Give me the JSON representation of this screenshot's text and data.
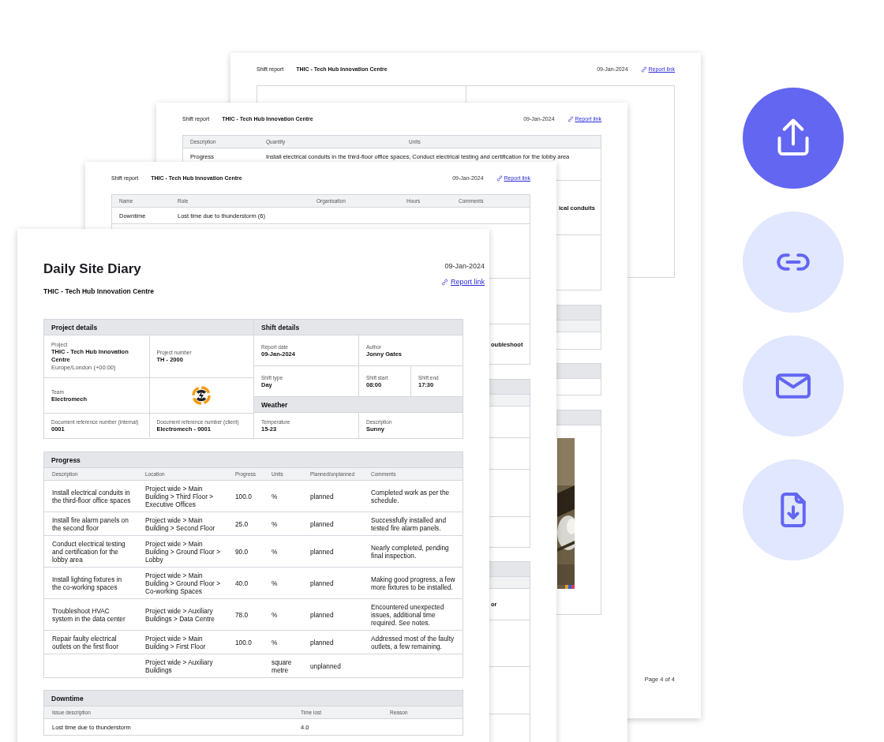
{
  "pages": [
    {
      "header": {
        "label": "Shift report",
        "project": "THIC - Tech Hub Innovation Centre",
        "date": "09-Jan-2024",
        "link": "Report link"
      },
      "footer": "Page 4 of 4"
    },
    {
      "header": {
        "label": "Shift report",
        "project": "THIC - Tech Hub Innovation Centre",
        "date": "09-Jan-2024",
        "link": "Report link"
      },
      "table": {
        "columns": [
          "Description",
          "Quantity",
          "Units"
        ],
        "rows": [
          [
            "Progress",
            "Install electrical conduits in the third-floor office spaces, Conduct electrical testing and certification for the lobby area"
          ]
        ]
      },
      "fragments": [
        "ical conduits"
      ],
      "picture": {
        "kind": "picture"
      }
    },
    {
      "header": {
        "label": "Shift report",
        "project": "THIC - Tech Hub Innovation Centre",
        "date": "09-Jan-2024",
        "link": "Report link"
      },
      "table": {
        "columns": [
          "Name",
          "Role",
          "Organisation",
          "Hours",
          "Comments"
        ],
        "rows": [
          [
            "Downtime",
            "Lost time due to thunderstorm (6)"
          ]
        ]
      },
      "fragments": [
        "oubleshoot",
        "or"
      ]
    }
  ],
  "diary": {
    "title": "Daily Site Diary",
    "project": "THIC - Tech Hub Innovation Centre",
    "date": "09-Jan-2024",
    "link": "Report link",
    "project_details": {
      "title": "Project details",
      "rows": [
        [
          {
            "kind": "field",
            "label": "Project",
            "value": "THIC - Tech Hub Innovation Centre",
            "note": "Europe/London (+00:00)"
          },
          {
            "kind": "field",
            "label": "Project number",
            "value": "TH - 2000"
          }
        ],
        [
          {
            "kind": "field",
            "label": "Team",
            "value": "Electromech"
          },
          {
            "kind": "logo"
          }
        ],
        [
          {
            "kind": "field",
            "label": "Document reference number (internal)",
            "value": "0001"
          },
          {
            "kind": "field",
            "label": "Document reference number (client)",
            "value": "Electromech - 0001"
          }
        ]
      ]
    },
    "shift_details": {
      "title": "Shift details",
      "rows": [
        [
          {
            "kind": "field",
            "label": "Report date",
            "value": "09-Jan-2024"
          },
          {
            "kind": "field",
            "label": "Author",
            "value": "Jonny Gates"
          }
        ],
        [
          {
            "kind": "field",
            "label": "Shift type",
            "value": "Day"
          },
          {
            "kind": "field",
            "label": "Shift start",
            "value": "08:00"
          },
          {
            "kind": "field",
            "label": "Shift end",
            "value": "17:30"
          }
        ]
      ]
    },
    "weather": {
      "title": "Weather",
      "rows": [
        [
          {
            "kind": "field",
            "label": "Temperature",
            "value": "15-23"
          },
          {
            "kind": "field",
            "label": "Description",
            "value": "Sunny"
          }
        ]
      ]
    },
    "progress": {
      "title": "Progress",
      "columns": [
        "Description",
        "Location",
        "Progress",
        "Units",
        "Planned/unplanned",
        "Comments"
      ],
      "rows": [
        {
          "description": "Install electrical conduits in the third-floor office spaces",
          "location": "Project wide > Main Building > Third Floor > Executive Offices",
          "progress": "100.0",
          "units": "%",
          "planned": "planned",
          "comments": "Completed work as per the schedule."
        },
        {
          "description": "Install fire alarm panels on the second floor",
          "location": "Project wide > Main Building > Second Floor",
          "progress": "25.0",
          "units": "%",
          "planned": "planned",
          "comments": "Successfully installed and tested fire alarm panels."
        },
        {
          "description": "Conduct electrical testing and certification for the lobby area",
          "location": "Project wide > Main Building > Ground Floor > Lobby",
          "progress": "90.0",
          "units": "%",
          "planned": "planned",
          "comments": "Nearly completed, pending final inspection."
        },
        {
          "description": "Install lighting fixtures in the co-working spaces",
          "location": "Project wide > Main Building > Ground Floor > Co-working Spaces",
          "progress": "40.0",
          "units": "%",
          "planned": "planned",
          "comments": "Making good progress, a few more fixtures to be installed."
        },
        {
          "description": "Troubleshoot HVAC system in the data center",
          "location": "Project wide > Auxiliary Buildings > Data Centre",
          "progress": "78.0",
          "units": "%",
          "planned": "planned",
          "comments": "Encountered unexpected issues, additional time required. See notes."
        },
        {
          "description": "Repair faulty electrical outlets on the first floor",
          "location": "Project wide > Main Building > First Floor",
          "progress": "100.0",
          "units": "%",
          "planned": "planned",
          "comments": "Addressed most of the faulty outlets, a few remaining."
        },
        {
          "location": "Project wide > Auxiliary Buildings",
          "units": "square metre",
          "planned": "unplanned"
        }
      ]
    },
    "downtime": {
      "title": "Downtime",
      "columns": [
        "Issue description",
        "Time lost",
        "Reason"
      ],
      "rows": [
        {
          "description": "Lost time due to thunderstorm",
          "time_lost": "4.0"
        }
      ]
    }
  },
  "actions": [
    {
      "kind": "share",
      "selected": true
    },
    {
      "kind": "link",
      "selected": false
    },
    {
      "kind": "email",
      "selected": false
    },
    {
      "kind": "download",
      "selected": false
    }
  ]
}
